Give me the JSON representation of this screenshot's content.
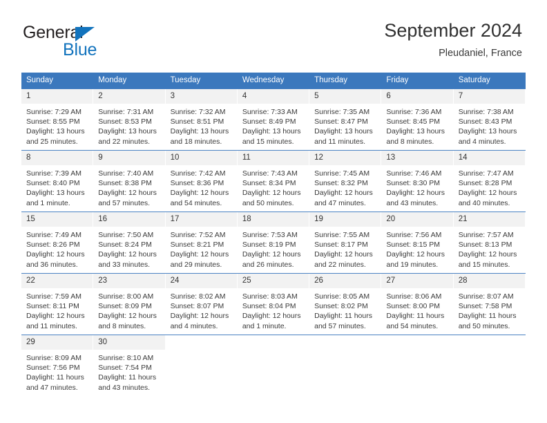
{
  "brand": {
    "name_part1": "General",
    "name_part2": "Blue",
    "triangle_color": "#1273BD",
    "text_color": "#231F20"
  },
  "header": {
    "title": "September 2024",
    "subtitle": "Pleudaniel, France",
    "accent_color": "#3B78BD",
    "daynum_background": "#F2F2F2"
  },
  "weekday_headers": [
    "Sunday",
    "Monday",
    "Tuesday",
    "Wednesday",
    "Thursday",
    "Friday",
    "Saturday"
  ],
  "labels": {
    "sunrise_prefix": "Sunrise:",
    "sunset_prefix": "Sunset:",
    "daylight_prefix": "Daylight:"
  },
  "weeks": [
    [
      {
        "day": "1",
        "sunrise": "Sunrise: 7:29 AM",
        "sunset": "Sunset: 8:55 PM",
        "daylight_line1": "Daylight: 13 hours",
        "daylight_line2": "and 25 minutes."
      },
      {
        "day": "2",
        "sunrise": "Sunrise: 7:31 AM",
        "sunset": "Sunset: 8:53 PM",
        "daylight_line1": "Daylight: 13 hours",
        "daylight_line2": "and 22 minutes."
      },
      {
        "day": "3",
        "sunrise": "Sunrise: 7:32 AM",
        "sunset": "Sunset: 8:51 PM",
        "daylight_line1": "Daylight: 13 hours",
        "daylight_line2": "and 18 minutes."
      },
      {
        "day": "4",
        "sunrise": "Sunrise: 7:33 AM",
        "sunset": "Sunset: 8:49 PM",
        "daylight_line1": "Daylight: 13 hours",
        "daylight_line2": "and 15 minutes."
      },
      {
        "day": "5",
        "sunrise": "Sunrise: 7:35 AM",
        "sunset": "Sunset: 8:47 PM",
        "daylight_line1": "Daylight: 13 hours",
        "daylight_line2": "and 11 minutes."
      },
      {
        "day": "6",
        "sunrise": "Sunrise: 7:36 AM",
        "sunset": "Sunset: 8:45 PM",
        "daylight_line1": "Daylight: 13 hours",
        "daylight_line2": "and 8 minutes."
      },
      {
        "day": "7",
        "sunrise": "Sunrise: 7:38 AM",
        "sunset": "Sunset: 8:43 PM",
        "daylight_line1": "Daylight: 13 hours",
        "daylight_line2": "and 4 minutes."
      }
    ],
    [
      {
        "day": "8",
        "sunrise": "Sunrise: 7:39 AM",
        "sunset": "Sunset: 8:40 PM",
        "daylight_line1": "Daylight: 13 hours",
        "daylight_line2": "and 1 minute."
      },
      {
        "day": "9",
        "sunrise": "Sunrise: 7:40 AM",
        "sunset": "Sunset: 8:38 PM",
        "daylight_line1": "Daylight: 12 hours",
        "daylight_line2": "and 57 minutes."
      },
      {
        "day": "10",
        "sunrise": "Sunrise: 7:42 AM",
        "sunset": "Sunset: 8:36 PM",
        "daylight_line1": "Daylight: 12 hours",
        "daylight_line2": "and 54 minutes."
      },
      {
        "day": "11",
        "sunrise": "Sunrise: 7:43 AM",
        "sunset": "Sunset: 8:34 PM",
        "daylight_line1": "Daylight: 12 hours",
        "daylight_line2": "and 50 minutes."
      },
      {
        "day": "12",
        "sunrise": "Sunrise: 7:45 AM",
        "sunset": "Sunset: 8:32 PM",
        "daylight_line1": "Daylight: 12 hours",
        "daylight_line2": "and 47 minutes."
      },
      {
        "day": "13",
        "sunrise": "Sunrise: 7:46 AM",
        "sunset": "Sunset: 8:30 PM",
        "daylight_line1": "Daylight: 12 hours",
        "daylight_line2": "and 43 minutes."
      },
      {
        "day": "14",
        "sunrise": "Sunrise: 7:47 AM",
        "sunset": "Sunset: 8:28 PM",
        "daylight_line1": "Daylight: 12 hours",
        "daylight_line2": "and 40 minutes."
      }
    ],
    [
      {
        "day": "15",
        "sunrise": "Sunrise: 7:49 AM",
        "sunset": "Sunset: 8:26 PM",
        "daylight_line1": "Daylight: 12 hours",
        "daylight_line2": "and 36 minutes."
      },
      {
        "day": "16",
        "sunrise": "Sunrise: 7:50 AM",
        "sunset": "Sunset: 8:24 PM",
        "daylight_line1": "Daylight: 12 hours",
        "daylight_line2": "and 33 minutes."
      },
      {
        "day": "17",
        "sunrise": "Sunrise: 7:52 AM",
        "sunset": "Sunset: 8:21 PM",
        "daylight_line1": "Daylight: 12 hours",
        "daylight_line2": "and 29 minutes."
      },
      {
        "day": "18",
        "sunrise": "Sunrise: 7:53 AM",
        "sunset": "Sunset: 8:19 PM",
        "daylight_line1": "Daylight: 12 hours",
        "daylight_line2": "and 26 minutes."
      },
      {
        "day": "19",
        "sunrise": "Sunrise: 7:55 AM",
        "sunset": "Sunset: 8:17 PM",
        "daylight_line1": "Daylight: 12 hours",
        "daylight_line2": "and 22 minutes."
      },
      {
        "day": "20",
        "sunrise": "Sunrise: 7:56 AM",
        "sunset": "Sunset: 8:15 PM",
        "daylight_line1": "Daylight: 12 hours",
        "daylight_line2": "and 19 minutes."
      },
      {
        "day": "21",
        "sunrise": "Sunrise: 7:57 AM",
        "sunset": "Sunset: 8:13 PM",
        "daylight_line1": "Daylight: 12 hours",
        "daylight_line2": "and 15 minutes."
      }
    ],
    [
      {
        "day": "22",
        "sunrise": "Sunrise: 7:59 AM",
        "sunset": "Sunset: 8:11 PM",
        "daylight_line1": "Daylight: 12 hours",
        "daylight_line2": "and 11 minutes."
      },
      {
        "day": "23",
        "sunrise": "Sunrise: 8:00 AM",
        "sunset": "Sunset: 8:09 PM",
        "daylight_line1": "Daylight: 12 hours",
        "daylight_line2": "and 8 minutes."
      },
      {
        "day": "24",
        "sunrise": "Sunrise: 8:02 AM",
        "sunset": "Sunset: 8:07 PM",
        "daylight_line1": "Daylight: 12 hours",
        "daylight_line2": "and 4 minutes."
      },
      {
        "day": "25",
        "sunrise": "Sunrise: 8:03 AM",
        "sunset": "Sunset: 8:04 PM",
        "daylight_line1": "Daylight: 12 hours",
        "daylight_line2": "and 1 minute."
      },
      {
        "day": "26",
        "sunrise": "Sunrise: 8:05 AM",
        "sunset": "Sunset: 8:02 PM",
        "daylight_line1": "Daylight: 11 hours",
        "daylight_line2": "and 57 minutes."
      },
      {
        "day": "27",
        "sunrise": "Sunrise: 8:06 AM",
        "sunset": "Sunset: 8:00 PM",
        "daylight_line1": "Daylight: 11 hours",
        "daylight_line2": "and 54 minutes."
      },
      {
        "day": "28",
        "sunrise": "Sunrise: 8:07 AM",
        "sunset": "Sunset: 7:58 PM",
        "daylight_line1": "Daylight: 11 hours",
        "daylight_line2": "and 50 minutes."
      }
    ],
    [
      {
        "day": "29",
        "sunrise": "Sunrise: 8:09 AM",
        "sunset": "Sunset: 7:56 PM",
        "daylight_line1": "Daylight: 11 hours",
        "daylight_line2": "and 47 minutes."
      },
      {
        "day": "30",
        "sunrise": "Sunrise: 8:10 AM",
        "sunset": "Sunset: 7:54 PM",
        "daylight_line1": "Daylight: 11 hours",
        "daylight_line2": "and 43 minutes."
      },
      {
        "day": "",
        "sunrise": "",
        "sunset": "",
        "daylight_line1": "",
        "daylight_line2": ""
      },
      {
        "day": "",
        "sunrise": "",
        "sunset": "",
        "daylight_line1": "",
        "daylight_line2": ""
      },
      {
        "day": "",
        "sunrise": "",
        "sunset": "",
        "daylight_line1": "",
        "daylight_line2": ""
      },
      {
        "day": "",
        "sunrise": "",
        "sunset": "",
        "daylight_line1": "",
        "daylight_line2": ""
      },
      {
        "day": "",
        "sunrise": "",
        "sunset": "",
        "daylight_line1": "",
        "daylight_line2": ""
      }
    ]
  ]
}
